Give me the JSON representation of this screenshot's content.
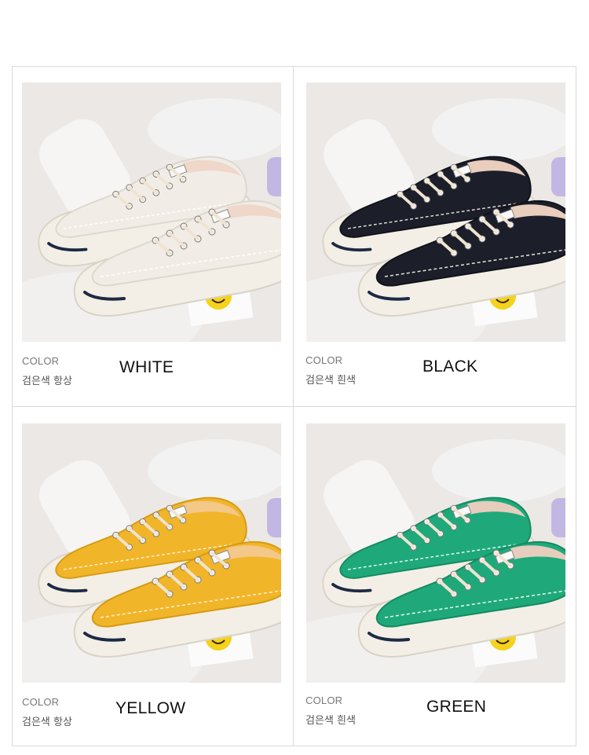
{
  "cards": [
    {
      "color_label": "COLOR",
      "color_sub": "검은색 항상",
      "color_name": "WHITE",
      "upper": "#f1ede6",
      "upper_shade": "#dcd7cf",
      "lining": "#efd7c9",
      "thread": "#ffffff"
    },
    {
      "color_label": "COLOR",
      "color_sub": "검은색 흰색",
      "color_name": "BLACK",
      "upper": "#1c1f2a",
      "upper_shade": "#10121a",
      "lining": "#e9cdbd",
      "thread": "#e8e3d8"
    },
    {
      "color_label": "COLOR",
      "color_sub": "검은색 항상",
      "color_name": "YELLOW",
      "upper": "#f1b52a",
      "upper_shade": "#d69a12",
      "lining": "#f3c888",
      "thread": "#fff3d0"
    },
    {
      "color_label": "COLOR",
      "color_sub": "검은색 흰색",
      "color_name": "GREEN",
      "upper": "#1fa97a",
      "upper_shade": "#138a60",
      "lining": "#e7cdbd",
      "thread": "#e9fff4"
    }
  ],
  "colors": {
    "sole": "#f3efe6",
    "toe_stripe": "#1d2a44",
    "lace": "#efe4d2",
    "sticker": "#f5d21c"
  }
}
